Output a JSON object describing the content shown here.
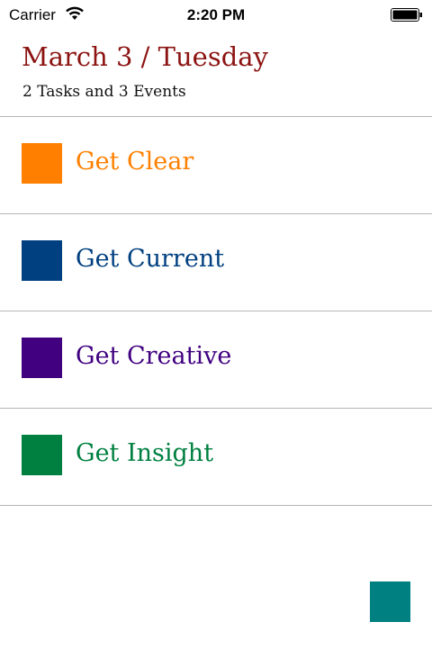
{
  "status_bar": {
    "carrier": "Carrier",
    "time": "2:20 PM"
  },
  "header": {
    "date": "March 3 / Tuesday",
    "summary": "2 Tasks and 3 Events"
  },
  "items": [
    {
      "label": "Get Clear",
      "color": "#ff8000"
    },
    {
      "label": "Get Current",
      "color": "#004080"
    },
    {
      "label": "Get Creative",
      "color": "#400080"
    },
    {
      "label": "Get Insight",
      "color": "#008040"
    }
  ],
  "add_button": {
    "color": "#008080"
  }
}
